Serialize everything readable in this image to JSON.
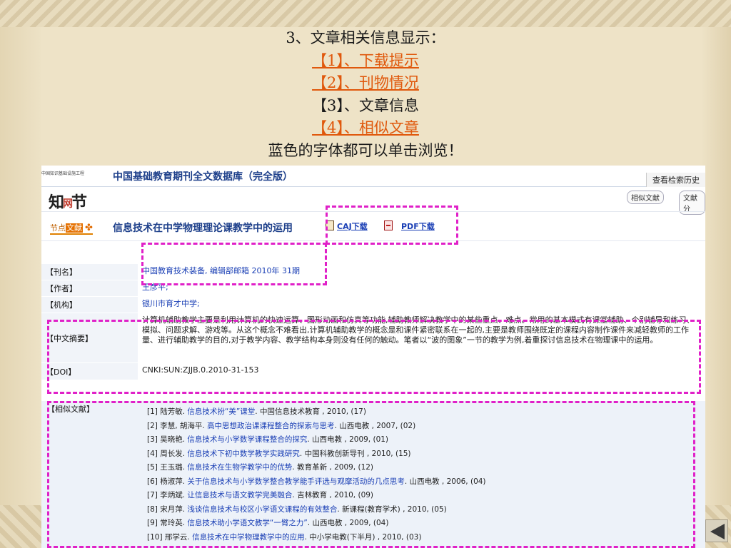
{
  "slide": {
    "heading": "3、文章相关信息显示：",
    "items": [
      "【1】、下载提示",
      "【2】、刊物情况",
      "【3】、文章信息",
      "【4】、相似文章"
    ],
    "footer": "蓝色的字体都可以单击浏览！"
  },
  "colors": {
    "link_orange": "#e0580c",
    "link_blue": "#1a3fb5",
    "callout": "#e020c8"
  },
  "db": {
    "tiny_header": "中国知识基础设施工程",
    "title": "中国基础教育期刊全文数据库（完全版）",
    "history_button": "查看检索历史",
    "logo_text": "知节",
    "logo_mid": "网",
    "tabs": [
      "相似文献",
      "文献分"
    ]
  },
  "article": {
    "node_prefix": "节点",
    "node_highlight": "文献",
    "title": "信息技术在中学物理理论课教学中的运用",
    "caj_download": "CAJ下载",
    "pdf_download": "PDF下载"
  },
  "meta": {
    "journal_label": "【刊名】",
    "journal": "中国教育技术装备, 编辑部邮箱  2010年 31期",
    "author_label": "【作者】",
    "author": "王彦平;",
    "org_label": "【机构】",
    "org": "银川市育才中学;",
    "abstract_label": "【中文摘要】",
    "abstract": "计算机辅助教学主要是利用计算机的快速运算、图形动画和仿真等功能,辅助教师解决教学中的某些重点、难点。常用的基本模式有课堂辅助、个别辅导和练习、模拟、问题求解、游戏等。从这个概念不难看出,计算机辅助教学的概念是和课件紧密联系在一起的,主要是教师围绕既定的课程内容制作课件来减轻教师的工作量、进行辅助教学的目的,对于教学内容、教学结构本身则没有任何的触动。笔者以“波的图象”一节的教学为例,着重探讨信息技术在物理课中的运用。",
    "doi_label": "【DOI】",
    "doi": "CNKI:SUN:ZJJB.0.2010-31-153"
  },
  "similar": {
    "label": "【相似文献】",
    "items": [
      {
        "pre": "[1] 陆芳敏. ",
        "title": "信息技术扮“美”课堂",
        "post": ". 中国信息技术教育 , 2010, (17)"
      },
      {
        "pre": "[2] 李慧, 胡海平. ",
        "title": "高中思想政治课课程整合的探索与思考",
        "post": ". 山西电教 , 2007, (02)"
      },
      {
        "pre": "[3] 吴晓艳. ",
        "title": "信息技术与小学数学课程整合的探究",
        "post": ". 山西电教 , 2009, (01)"
      },
      {
        "pre": "[4] 周长发. ",
        "title": "信息技术下初中数学教学实践研究",
        "post": ". 中国科教创新导刊 , 2010, (15)"
      },
      {
        "pre": "[5] 王玉璐. ",
        "title": "信息技术在生物学教学中的优势",
        "post": ". 教育革新 , 2009, (12)"
      },
      {
        "pre": "[6] 杨淑萍. ",
        "title": "关于信息技术与小学数学整合教学能手评选与观摩活动的几点思考",
        "post": ". 山西电教 , 2006, (04)"
      },
      {
        "pre": "[7] 李炳斌. ",
        "title": "让信息技术与语文教学完美融合",
        "post": ". 吉林教育 , 2010, (09)"
      },
      {
        "pre": "[8] 宋月萍. ",
        "title": "浅谈信息技术与校区小学语文课程的有效整合",
        "post": ". 新课程(教育学术) , 2010, (05)"
      },
      {
        "pre": "[9] 常玲英. ",
        "title": "信息技术助小学语文教学“一臂之力”",
        "post": ". 山西电教 , 2009, (04)"
      },
      {
        "pre": "[10] 邢学云. ",
        "title": "信息技术在中学物理教学中的应用",
        "post": ". 中小学电教(下半月) , 2010, (03)"
      }
    ]
  }
}
